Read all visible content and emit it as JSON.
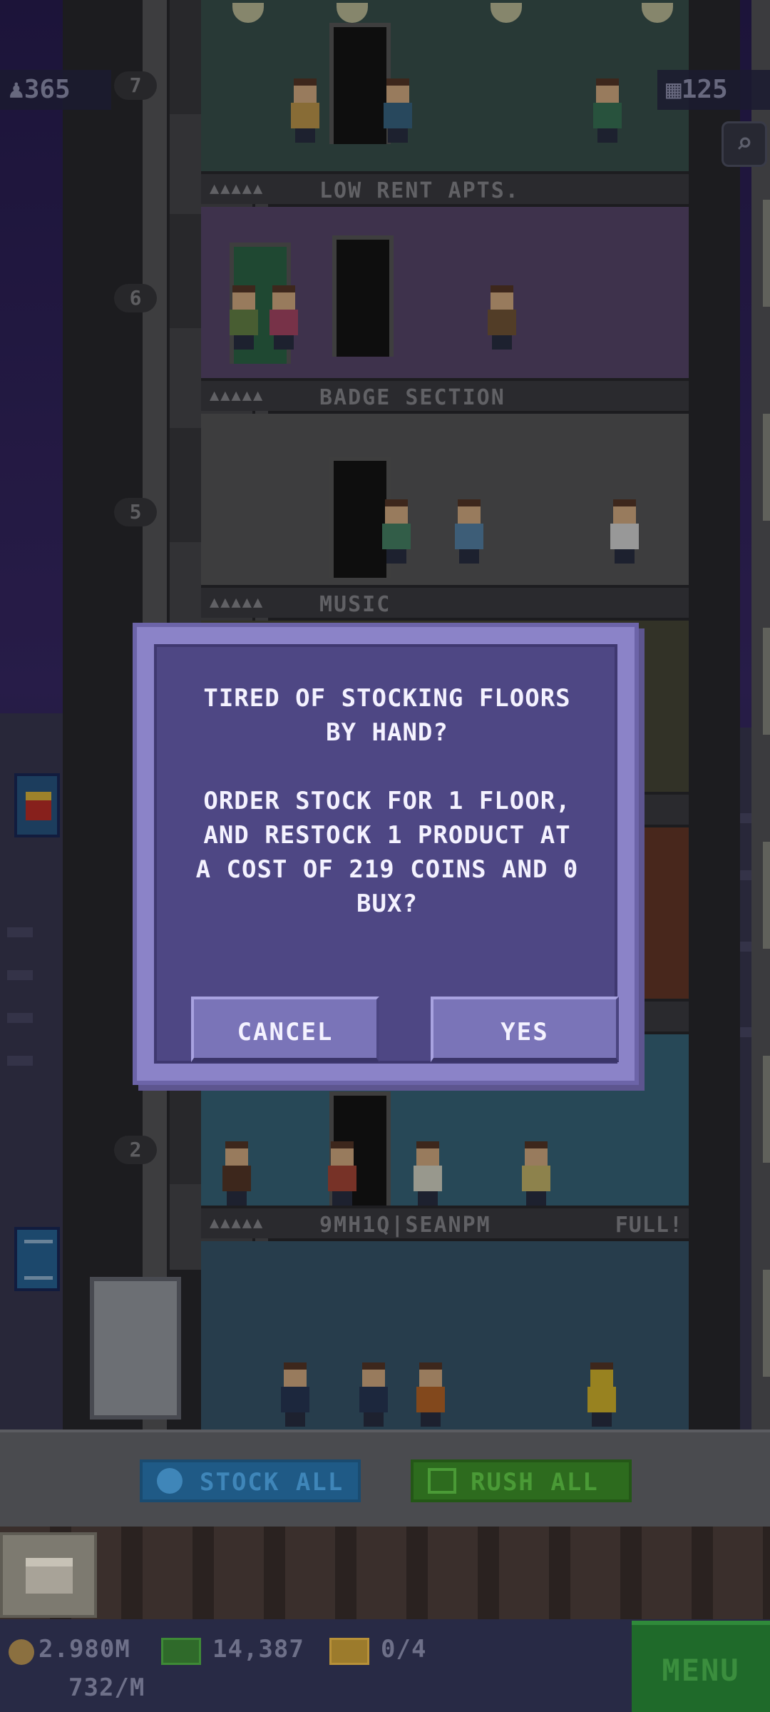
{
  "top_counters": {
    "population": "365",
    "floors": "125"
  },
  "floors": [
    {
      "number": "7",
      "name": "LOW RENT APTS.",
      "stars": "▲▲▲▲▲",
      "status": ""
    },
    {
      "number": "6",
      "name": "BADGE SECTION",
      "stars": "▲▲▲▲▲",
      "status": ""
    },
    {
      "number": "5",
      "name": "MUSIC",
      "stars": "▲▲▲▲▲",
      "status": ""
    },
    {
      "number": "2",
      "name": "9MH1Q|SEANPM",
      "stars": "▲▲▲▲▲",
      "status": "FULL!"
    }
  ],
  "dialog": {
    "message": "TIRED OF STOCKING FLOORS\nBY HAND?\n\nORDER STOCK FOR 1 FLOOR,\nAND RESTOCK 1 PRODUCT AT\nA COST OF 219 COINS AND 0\nBUX?",
    "cancel_label": "CANCEL",
    "yes_label": "YES"
  },
  "actions": {
    "stock_all_label": "STOCK ALL",
    "rush_all_label": "RUSH ALL"
  },
  "status": {
    "coins": "2.980M",
    "coins_rate": "732/M",
    "bux": "14,387",
    "tickets": "0/4",
    "menu_label": "MENU"
  },
  "colors": {
    "dialog_bg": "#4e4784",
    "dialog_border": "#8b83c8",
    "button": "#7a74b8",
    "stock_all": "#1f5a86",
    "rush_all": "#2d6b1e",
    "menu": "#1f6a2a"
  }
}
